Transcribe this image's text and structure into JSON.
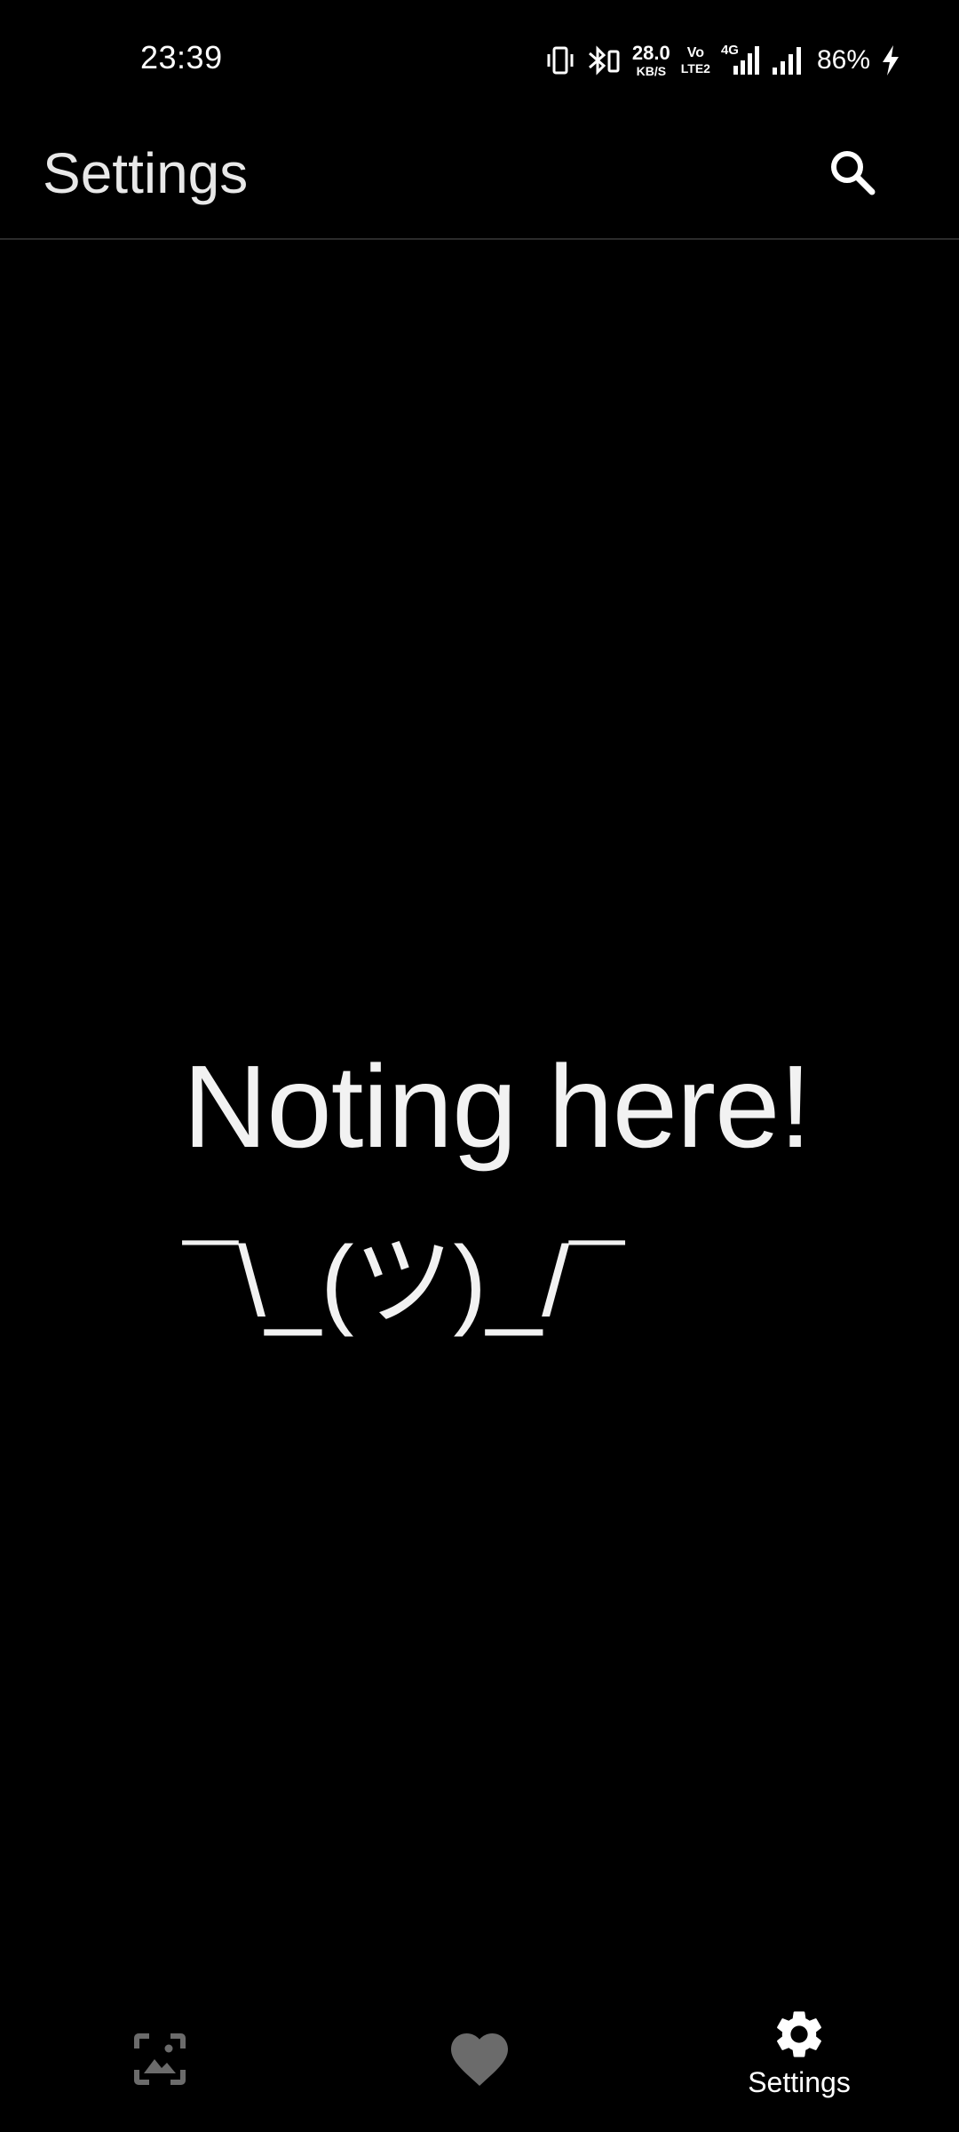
{
  "status_bar": {
    "time": "23:39",
    "net_speed_value": "28.0",
    "net_speed_unit": "KB/S",
    "volte_top": "Vo",
    "volte_bottom": "LTE2",
    "network_type": "4G",
    "battery_percent": "86%",
    "icons": [
      "vibrate-icon",
      "bluetooth-icon",
      "volte-icon",
      "signal-4g-icon",
      "signal-icon",
      "charging-icon"
    ]
  },
  "app_bar": {
    "title": "Settings",
    "search_icon": "search-icon"
  },
  "empty_state": {
    "title": "Noting here!",
    "shrug": "¯\\_(ツ)_/¯"
  },
  "bottom_nav": {
    "items": [
      {
        "icon": "wallpaper-icon",
        "label": "",
        "active": false
      },
      {
        "icon": "heart-icon",
        "label": "",
        "active": false
      },
      {
        "icon": "gear-icon",
        "label": "Settings",
        "active": true
      }
    ]
  },
  "colors": {
    "background": "#000000",
    "text_primary": "#ffffff",
    "text_secondary": "#e8e8e8",
    "inactive_icon": "#6b6b6b",
    "divider": "#2b2b2b"
  }
}
